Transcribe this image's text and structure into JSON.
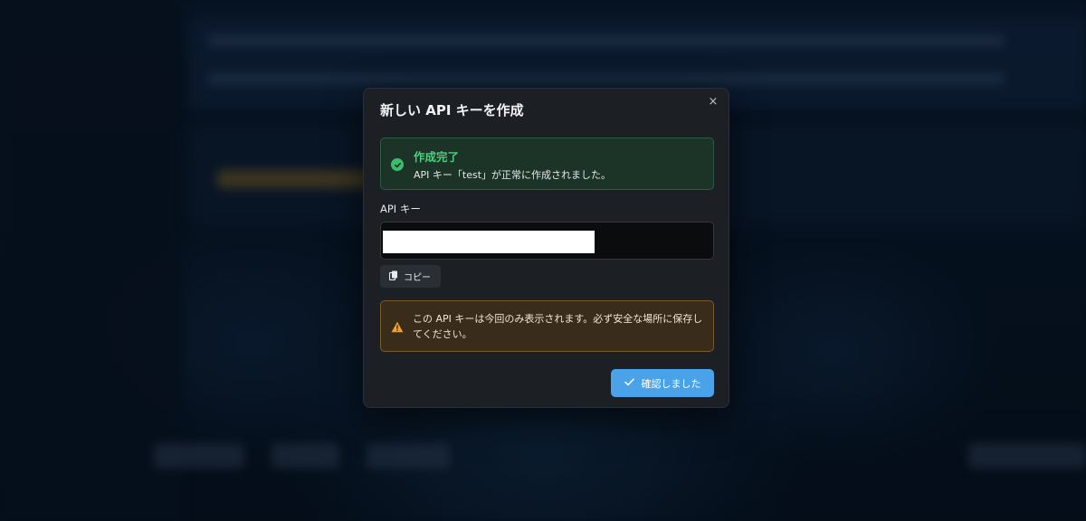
{
  "dialog": {
    "title": "新しい API キーを作成",
    "close_label": "×",
    "success": {
      "title": "作成完了",
      "message": "API キー「test」が正常に作成されました。"
    },
    "api_key": {
      "label": "API キー",
      "value": ""
    },
    "copy_button": "コピー",
    "warning": {
      "message": "この API キーは今回のみ表示されます。必ず安全な場所に保存してください。"
    },
    "confirm_button": "確認しました"
  },
  "colors": {
    "success_green": "#4cd07d",
    "warning_orange": "#e8a33a",
    "primary_blue": "#4aa3e8"
  },
  "icons": {
    "success": "check-circle-icon",
    "copy": "copy-icon",
    "warning": "warning-triangle-icon",
    "confirm": "check-icon",
    "close": "close-icon"
  }
}
